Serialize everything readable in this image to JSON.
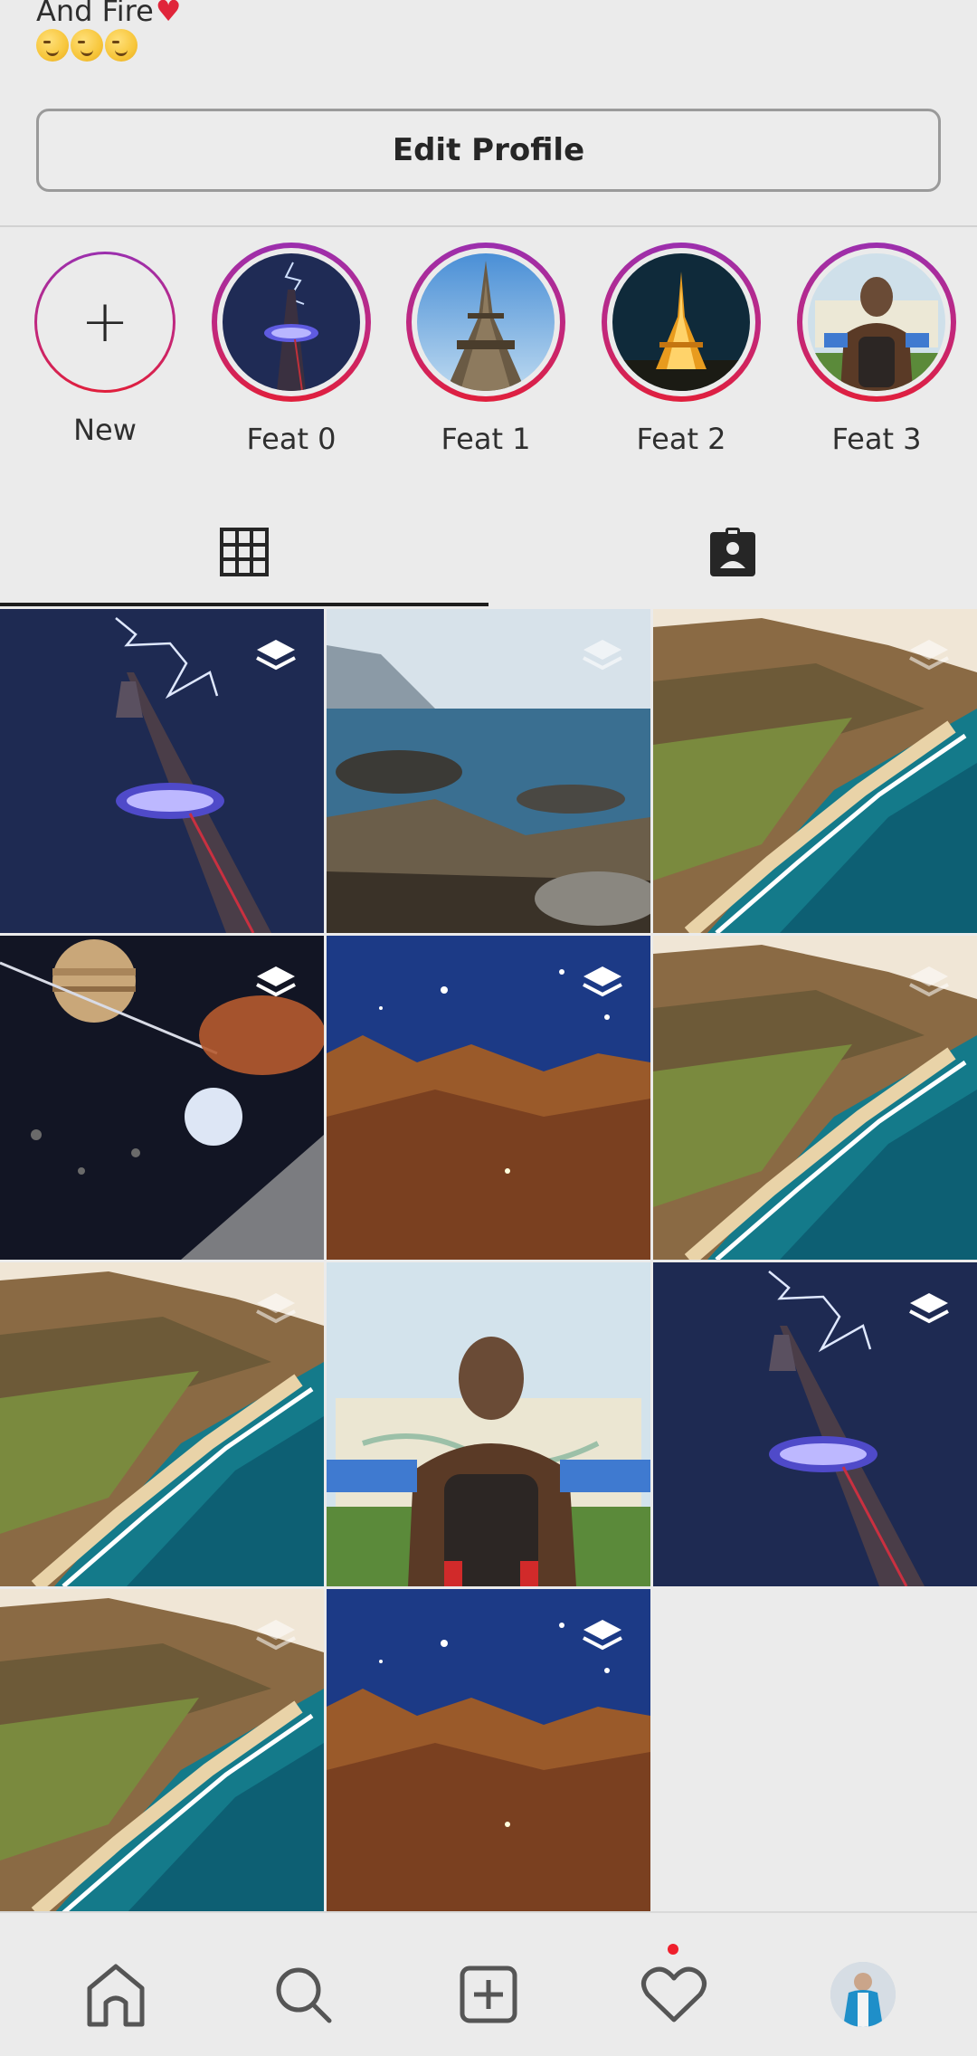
{
  "bio": {
    "line1": "And Fire",
    "heart": "♥",
    "emojis": [
      "smirk-emoji",
      "smirk-emoji",
      "wink-emoji"
    ]
  },
  "profile": {
    "edit_label": "Edit Profile"
  },
  "highlights": {
    "new_label": "New",
    "new_icon": "+",
    "items": [
      {
        "label": "Feat 0",
        "image": "tower-lightning"
      },
      {
        "label": "Feat 1",
        "image": "eiffel-day"
      },
      {
        "label": "Feat 2",
        "image": "eiffel-night"
      },
      {
        "label": "Feat 3",
        "image": "traveler-map"
      }
    ]
  },
  "tabs": {
    "active": "grid",
    "items": [
      {
        "icon": "grid-icon"
      },
      {
        "icon": "tagged-icon"
      }
    ]
  },
  "posts": [
    {
      "image": "tower-lightning",
      "multi": true
    },
    {
      "image": "rocky-coast",
      "multi": true
    },
    {
      "image": "coastline-aerial",
      "multi": true
    },
    {
      "image": "space-planets",
      "multi": true
    },
    {
      "image": "nebula",
      "multi": true
    },
    {
      "image": "coastline-aerial",
      "multi": true
    },
    {
      "image": "coastline-aerial",
      "multi": true
    },
    {
      "image": "traveler-map",
      "multi": false
    },
    {
      "image": "tower-lightning",
      "multi": true
    },
    {
      "image": "coastline-aerial",
      "multi": true
    },
    {
      "image": "nebula",
      "multi": true
    }
  ],
  "nav": {
    "items": [
      "home-icon",
      "search-icon",
      "add-post-icon",
      "heart-icon",
      "profile-avatar"
    ],
    "notification": true
  },
  "colors": {
    "ring_top": "#9b2fae",
    "ring_bottom": "#e01f3c",
    "notif": "#ef1f2c"
  }
}
